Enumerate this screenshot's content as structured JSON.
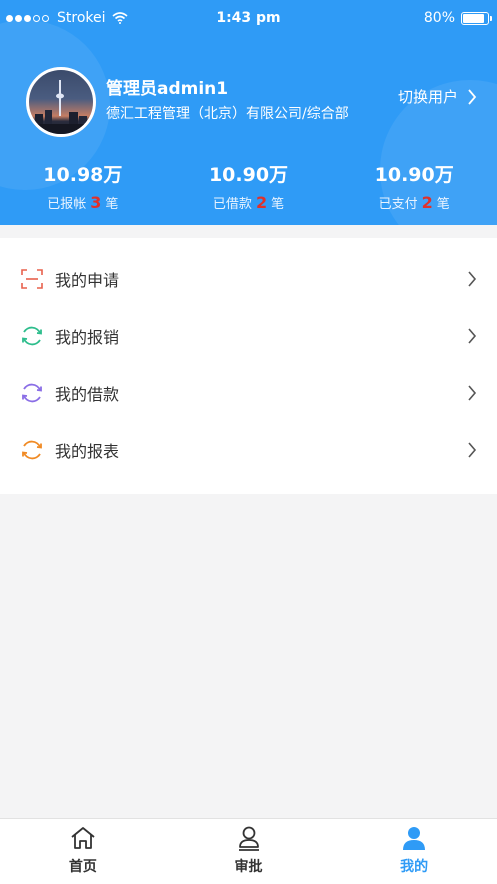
{
  "status_bar": {
    "carrier": "Strokei",
    "time": "1:43 pm",
    "battery": "80%"
  },
  "profile": {
    "username": "管理员admin1",
    "company": "德汇工程管理（北京）有限公司/综合部",
    "switch_label": "切换用户"
  },
  "stats": [
    {
      "amount": "10.98万",
      "prefix": "已报帐",
      "count": "3",
      "unit": "笔"
    },
    {
      "amount": "10.90万",
      "prefix": "已借款",
      "count": "2",
      "unit": "笔"
    },
    {
      "amount": "10.90万",
      "prefix": "已支付",
      "count": "2",
      "unit": "笔"
    }
  ],
  "menu": [
    {
      "label": "我的申请",
      "icon": "scan-icon",
      "color": "#e8604c"
    },
    {
      "label": "我的报销",
      "icon": "refresh-icon",
      "color": "#2dbd8c"
    },
    {
      "label": "我的借款",
      "icon": "refresh-icon",
      "color": "#8a6ee6"
    },
    {
      "label": "我的报表",
      "icon": "refresh-icon",
      "color": "#f08a24"
    }
  ],
  "tabbar": [
    {
      "label": "首页",
      "icon": "home-icon"
    },
    {
      "label": "审批",
      "icon": "approval-icon"
    },
    {
      "label": "我的",
      "icon": "user-icon",
      "active": true
    }
  ],
  "colors": {
    "primary": "#2f9bf6",
    "highlight": "#e0312b"
  }
}
